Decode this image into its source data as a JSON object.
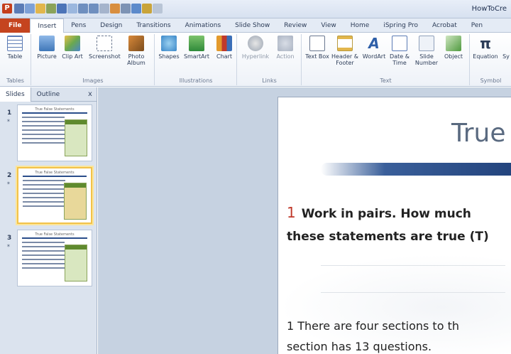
{
  "window": {
    "title": "HowToCre",
    "app_letter": "P"
  },
  "tabs": [
    {
      "label": "File"
    },
    {
      "label": "Insert"
    },
    {
      "label": "Pens"
    },
    {
      "label": "Design"
    },
    {
      "label": "Transitions"
    },
    {
      "label": "Animations"
    },
    {
      "label": "Slide Show"
    },
    {
      "label": "Review"
    },
    {
      "label": "View"
    },
    {
      "label": "Home"
    },
    {
      "label": "iSpring Pro"
    },
    {
      "label": "Acrobat"
    },
    {
      "label": "Pen"
    }
  ],
  "ribbon": {
    "groups": {
      "tables": "Tables",
      "images": "Images",
      "illustrations": "Illustrations",
      "links": "Links",
      "text": "Text",
      "symbols": "Symbol"
    },
    "buttons": {
      "table": "Table",
      "picture": "Picture",
      "clipart": "Clip Art",
      "screenshot": "Screenshot",
      "photoalbum": "Photo Album",
      "shapes": "Shapes",
      "smartart": "SmartArt",
      "chart": "Chart",
      "hyperlink": "Hyperlink",
      "action": "Action",
      "textbox": "Text Box",
      "headerfooter": "Header & Footer",
      "wordart": "WordArt",
      "datetime": "Date & Time",
      "slidenumber": "Slide Number",
      "object": "Object",
      "equation": "Equation",
      "symbol": "Sy"
    }
  },
  "leftpane": {
    "tab_slides": "Slides",
    "tab_outline": "Outline",
    "close": "x",
    "slides": [
      {
        "number": "1",
        "title": "True False Statements"
      },
      {
        "number": "2",
        "title": "True False Statements"
      },
      {
        "number": "3",
        "title": "True False Statements"
      }
    ]
  },
  "slide": {
    "title": "True",
    "q_number": "1",
    "q_line1": "Work in pairs. How much",
    "q_line2": "these statements are true (T)",
    "s_line1": "1 There are four sections to th",
    "s_line2": "section has 13 questions."
  },
  "colors": {
    "file_tab": "#c5441f",
    "accent_red": "#c0392b",
    "slide_bar": "#1f3f78"
  }
}
